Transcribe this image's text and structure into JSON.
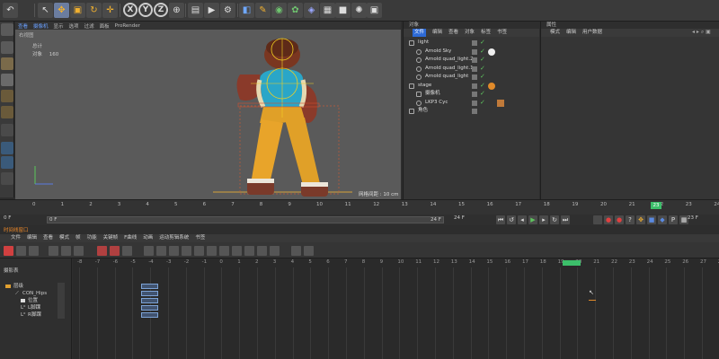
{
  "toolbar": {
    "icons": [
      "undo-icon",
      "pointer-icon",
      "move-icon",
      "scale-icon",
      "rotate-icon",
      "plus-icon",
      "x-axis-icon",
      "y-axis-icon",
      "z-axis-icon",
      "world-icon",
      "render-view-icon",
      "render-icon",
      "render-settings-icon",
      "cube-icon",
      "pen-icon",
      "subdivide-icon",
      "cloner-icon",
      "deformer-icon",
      "scene-icon",
      "camera-icon",
      "light-icon",
      "tag-icon"
    ],
    "x_label": "X",
    "y_label": "Y",
    "z_label": "Z"
  },
  "viewport": {
    "menu": [
      "查看",
      "摄像机",
      "显示",
      "选项",
      "过滤",
      "面板",
      "ProRender"
    ],
    "camera_label": "右视图",
    "stats_label": "总计",
    "objects_label": "对象",
    "objects_value": "160",
    "grid_info": "网格间距 : 10 cm"
  },
  "object_manager": {
    "header": "对象",
    "menu": [
      "文件",
      "编辑",
      "查看",
      "对象",
      "标签",
      "书签"
    ],
    "rows": [
      {
        "name": "light"
      },
      {
        "name": "Arnold Sky"
      },
      {
        "name": "Arnold quad_light.2"
      },
      {
        "name": "Arnold quad_light.1"
      },
      {
        "name": "Arnold quad_light"
      },
      {
        "name": "stage"
      },
      {
        "name": "摄像机"
      },
      {
        "name": "LKP3 Cyc"
      },
      {
        "name": "角色"
      }
    ]
  },
  "attribute_manager": {
    "header": "属性",
    "menu": [
      "模式",
      "编辑",
      "用户数据"
    ]
  },
  "timeline": {
    "ticks": [
      "0",
      "1",
      "2",
      "3",
      "4",
      "5",
      "6",
      "7",
      "8",
      "9",
      "10",
      "11",
      "12",
      "13",
      "14",
      "15",
      "16",
      "17",
      "18",
      "19",
      "20",
      "21",
      "22",
      "23",
      "24"
    ],
    "current_frame": "23",
    "frame_start": "0 F",
    "range_start": "0 F",
    "range_end": "24 F",
    "range_end2": "24 F",
    "frame_field": "23 F"
  },
  "dopesheet": {
    "tab": "时间线窗口",
    "menu": [
      "文件",
      "编辑",
      "查看",
      "模式",
      "帧",
      "功能",
      "关键帧",
      "F曲线",
      "动画",
      "运动剪辑系统",
      "书签"
    ],
    "left_header": "摄影表",
    "tracks": [
      {
        "name": "层级"
      },
      {
        "name": "CON_Hips"
      },
      {
        "name": "位置"
      },
      {
        "name": "L脚踝"
      },
      {
        "name": "R脚踝"
      }
    ],
    "ticks": [
      "-8",
      "-7",
      "-6",
      "-5",
      "-4",
      "-3",
      "-2",
      "-1",
      "0",
      "1",
      "2",
      "3",
      "4",
      "5",
      "6",
      "7",
      "8",
      "9",
      "10",
      "11",
      "12",
      "13",
      "14",
      "15",
      "16",
      "17",
      "18",
      "19",
      "20",
      "21",
      "22",
      "23",
      "24",
      "25",
      "26",
      "27",
      "28",
      "29",
      "30"
    ],
    "current_frame": "23"
  }
}
